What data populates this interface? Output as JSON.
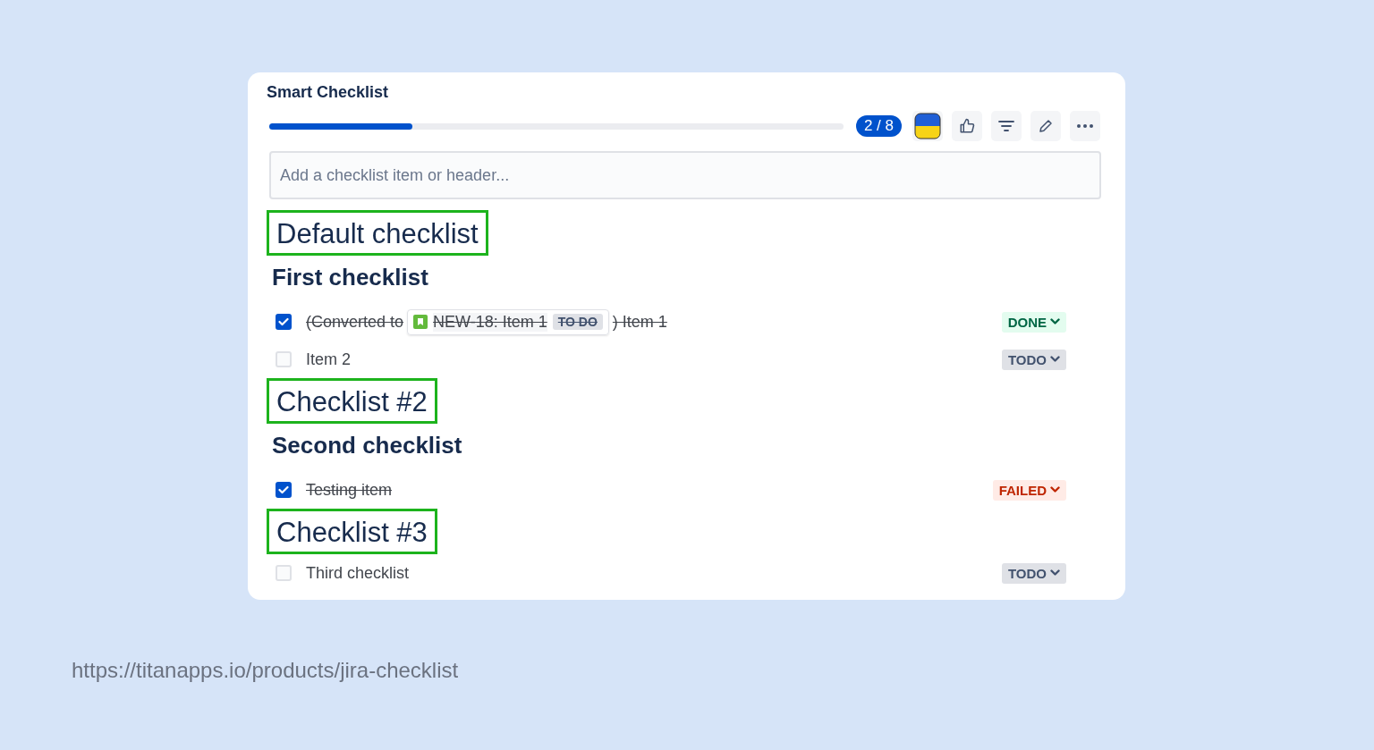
{
  "panel": {
    "title": "Smart Checklist",
    "progress": {
      "level": 0.25,
      "count": "2 / 8"
    },
    "input": {
      "placeholder": "Add a checklist item or header..."
    }
  },
  "entries": [
    {
      "kind": "header",
      "text": "Default checklist",
      "highlighted": true
    },
    {
      "kind": "subheader",
      "text": "First checklist"
    },
    {
      "kind": "issue_item",
      "checked": true,
      "prefix": "(Converted to",
      "issue_key": "NEW-18: Item 1",
      "issue_status": "TO DO",
      "suffix": ") Item 1",
      "status": {
        "kind": "done",
        "label": "DONE"
      }
    },
    {
      "kind": "item",
      "checked": false,
      "text": "Item 2",
      "status": {
        "kind": "todo",
        "label": "TODO"
      }
    },
    {
      "kind": "header",
      "text": "Checklist #2",
      "highlighted": true
    },
    {
      "kind": "subheader",
      "text": "Second checklist"
    },
    {
      "kind": "item",
      "checked": true,
      "text": "Testing item",
      "status": {
        "kind": "failed",
        "label": "FAILED"
      }
    },
    {
      "kind": "header",
      "text": "Checklist #3",
      "highlighted": true
    },
    {
      "kind": "item",
      "checked": false,
      "text": "Third checklist",
      "status": {
        "kind": "todo",
        "label": "TODO"
      }
    }
  ],
  "footer": {
    "url": "https://titanapps.io/products/jira-checklist"
  }
}
